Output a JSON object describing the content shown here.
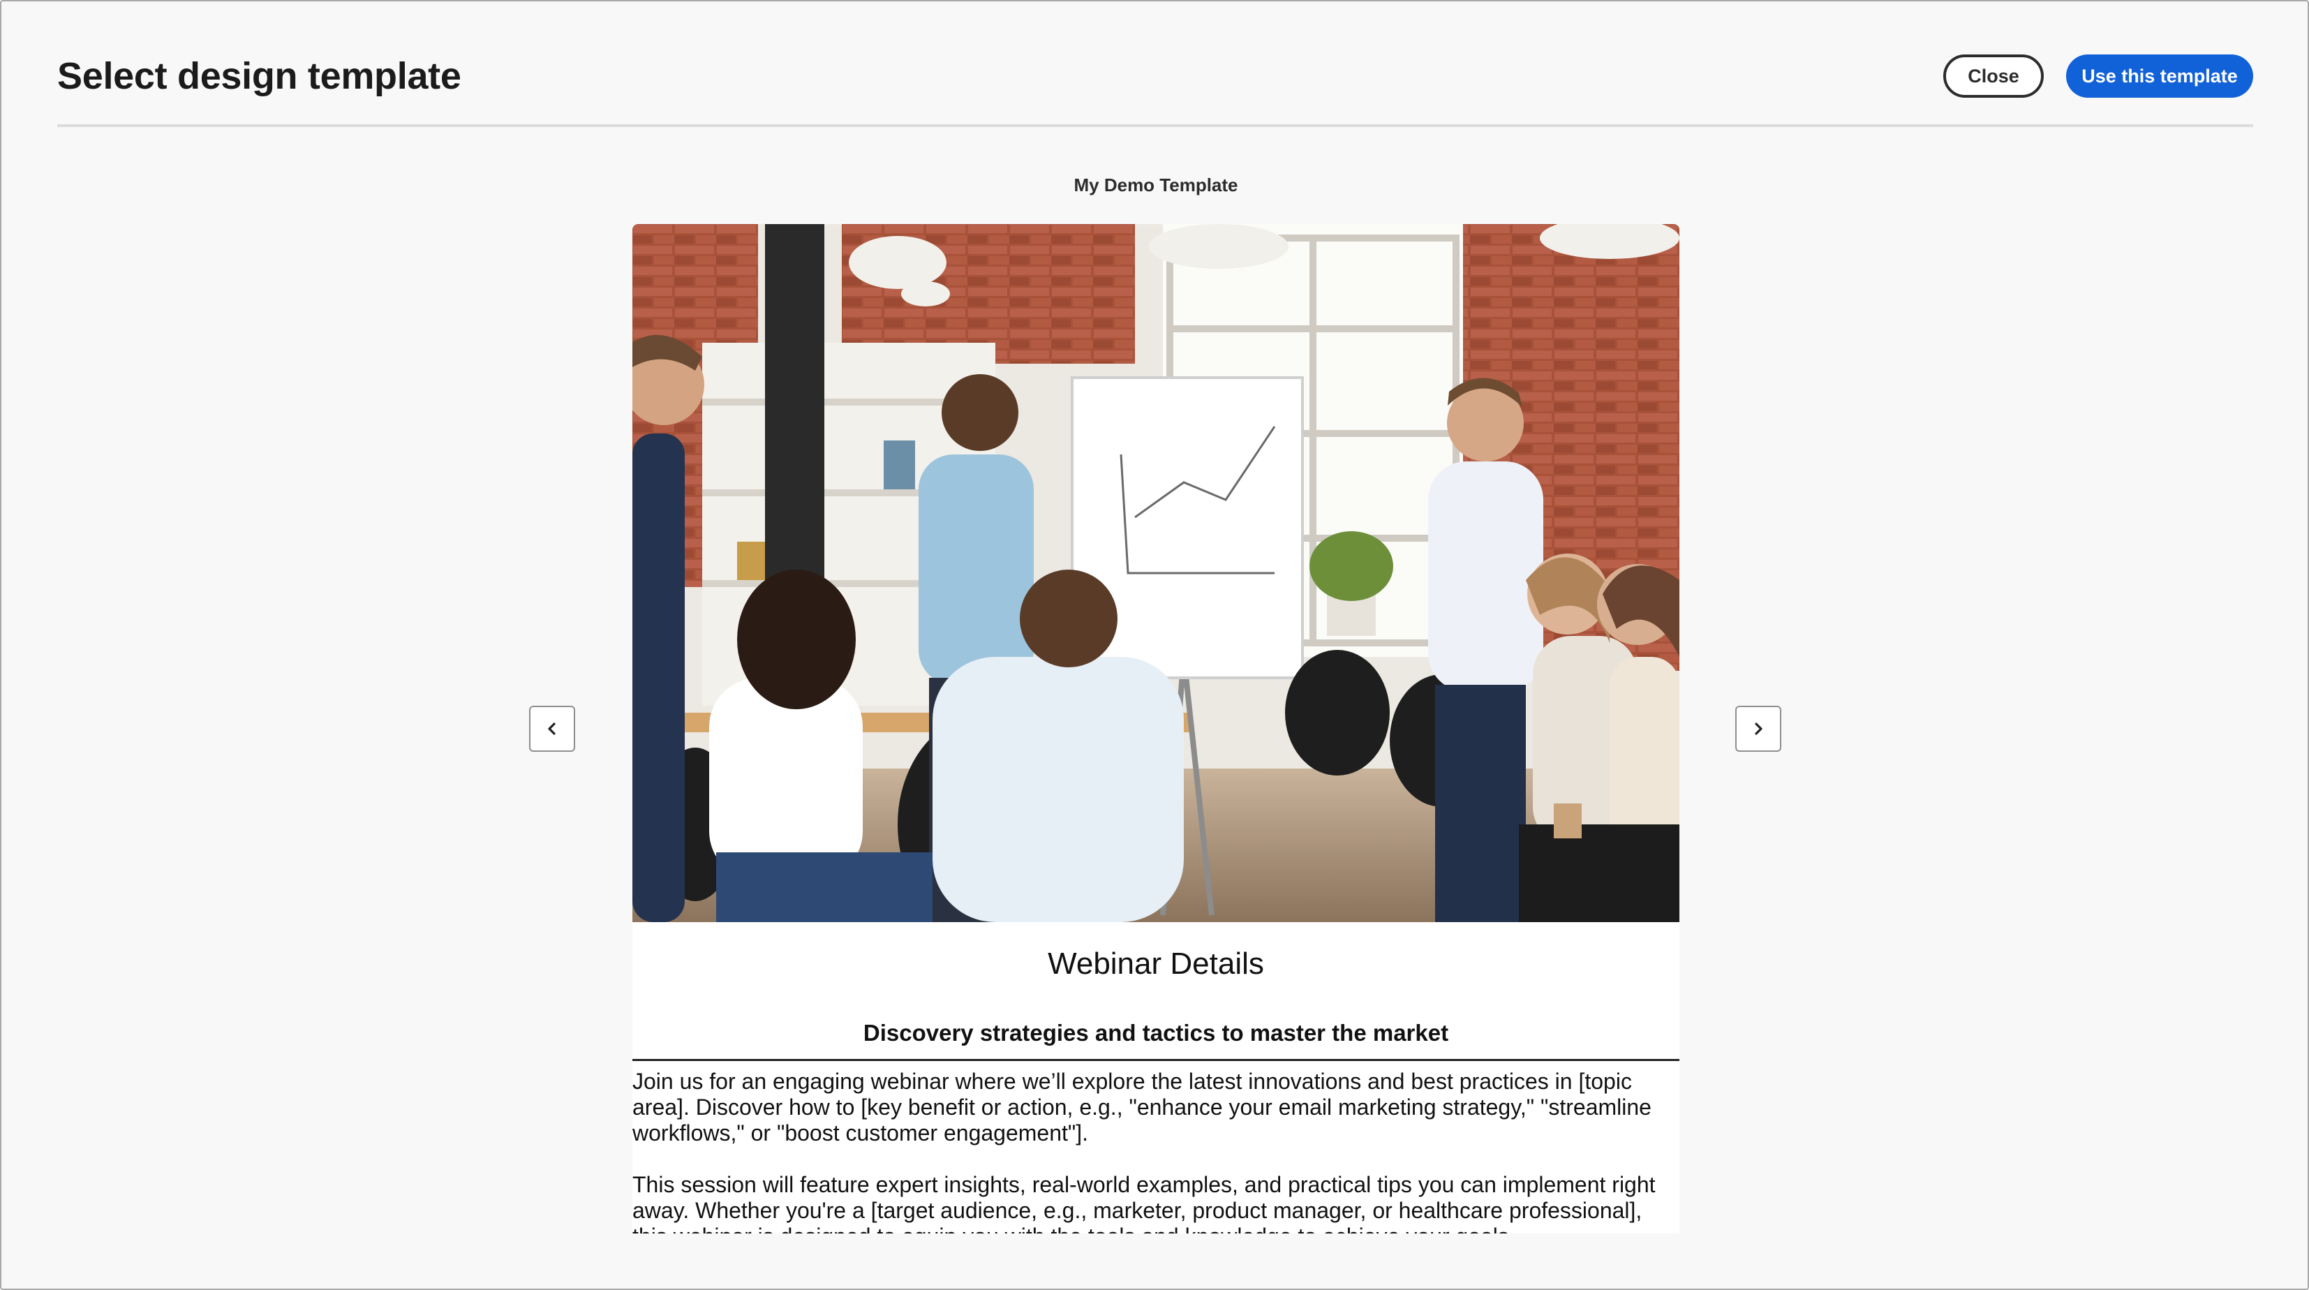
{
  "header": {
    "title": "Select design template",
    "close_label": "Close",
    "use_label": "Use this template"
  },
  "template": {
    "name": "My Demo Template"
  },
  "navigation": {
    "prev_icon": "chevron-left-icon",
    "next_icon": "chevron-right-icon"
  },
  "preview": {
    "image_description_icon": "team-meeting-photo",
    "heading": "Webinar Details",
    "subheading": "Discovery strategies and tactics to master the market",
    "paragraphs": [
      "Join us for an engaging webinar where we’ll explore the latest innovations and best practices in [topic area]. Discover how to [key benefit or action, e.g., \"enhance your email marketing strategy,\" \"streamline workflows,\" or \"boost customer engagement\"].",
      "This session will feature expert insights, real-world examples, and practical tips you can implement right away. Whether you're a [target audience, e.g., marketer, product manager, or healthcare professional], this webinar is designed to equip you with the tools and knowledge to achieve your goals."
    ]
  },
  "colors": {
    "primary_button": "#1161d8",
    "background": "#f8f8f8",
    "divider": "#dcdcdc"
  }
}
